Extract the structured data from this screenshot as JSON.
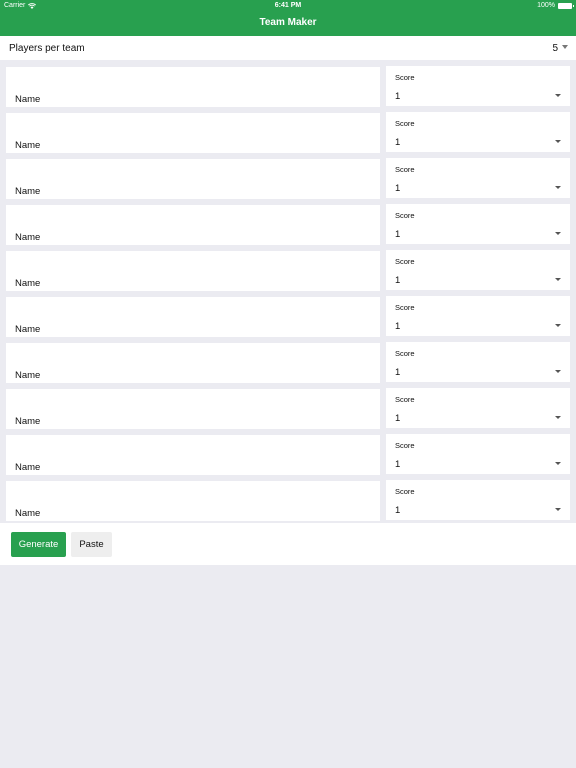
{
  "status_bar": {
    "carrier": "Carrier",
    "time": "6:41 PM",
    "battery": "100%"
  },
  "header": {
    "title": "Team Maker"
  },
  "players_per_team": {
    "label": "Players per team",
    "value": "5"
  },
  "players": [
    {
      "name_placeholder": "Name",
      "score_label": "Score",
      "score_value": "1"
    },
    {
      "name_placeholder": "Name",
      "score_label": "Score",
      "score_value": "1"
    },
    {
      "name_placeholder": "Name",
      "score_label": "Score",
      "score_value": "1"
    },
    {
      "name_placeholder": "Name",
      "score_label": "Score",
      "score_value": "1"
    },
    {
      "name_placeholder": "Name",
      "score_label": "Score",
      "score_value": "1"
    },
    {
      "name_placeholder": "Name",
      "score_label": "Score",
      "score_value": "1"
    },
    {
      "name_placeholder": "Name",
      "score_label": "Score",
      "score_value": "1"
    },
    {
      "name_placeholder": "Name",
      "score_label": "Score",
      "score_value": "1"
    },
    {
      "name_placeholder": "Name",
      "score_label": "Score",
      "score_value": "1"
    },
    {
      "name_placeholder": "Name",
      "score_label": "Score",
      "score_value": "1"
    }
  ],
  "actions": {
    "generate_label": "Generate",
    "paste_label": "Paste"
  },
  "colors": {
    "accent": "#28a04f",
    "background": "#ebebf1"
  }
}
